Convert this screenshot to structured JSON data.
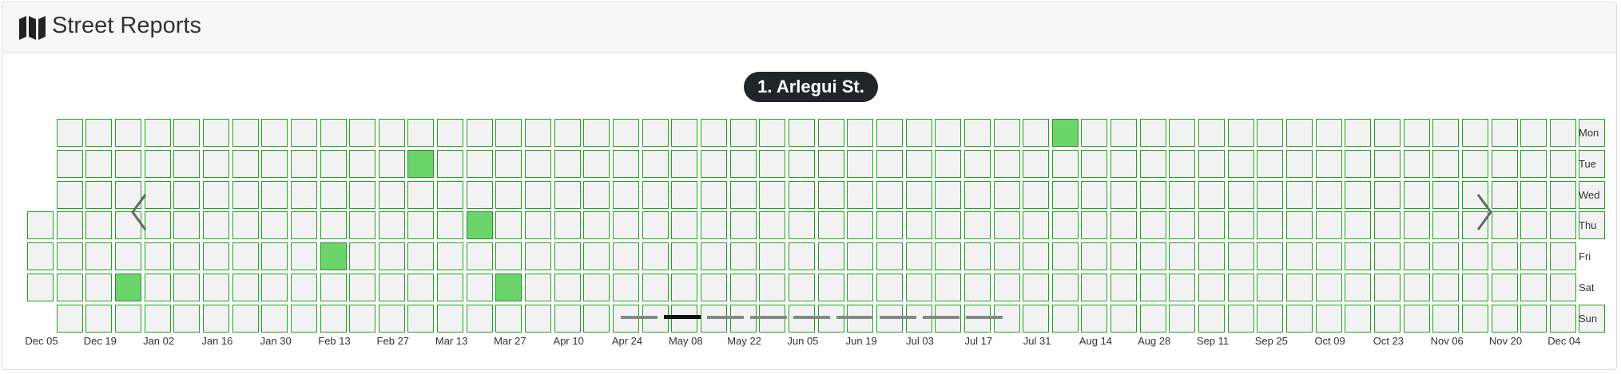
{
  "header": {
    "title": "Street Reports",
    "icon": "map-icon"
  },
  "carousel": {
    "current_street": "1. Arlegui St.",
    "indicator_count": 9,
    "active_indicator": 1,
    "prev_icon": "chevron-left-icon",
    "next_icon": "chevron-right-icon"
  },
  "calendar": {
    "day_labels": [
      "Mon",
      "Tue",
      "Wed",
      "Thu",
      "Fri",
      "Sat",
      "Sun"
    ],
    "month_labels": [
      "Dec 05",
      "Dec 19",
      "Jan 02",
      "Jan 16",
      "Jan 30",
      "Feb 13",
      "Feb 27",
      "Mar 13",
      "Mar 27",
      "Apr 10",
      "Apr 24",
      "May 08",
      "May 22",
      "Jun 05",
      "Jun 19",
      "Jul 03",
      "Jul 17",
      "Jul 31",
      "Aug 14",
      "Aug 28",
      "Sep 11",
      "Sep 25",
      "Oct 09",
      "Oct 23",
      "Nov 06",
      "Nov 20",
      "Dec 04"
    ],
    "week_count": 54,
    "first_week_days": [
      "Thu",
      "Fri",
      "Sat"
    ],
    "last_week_days": [
      "Mon",
      "Tue",
      "Wed",
      "Thu",
      "Sun"
    ],
    "reported_days": [
      {
        "week": 3,
        "day": "Sat"
      },
      {
        "week": 10,
        "day": "Fri"
      },
      {
        "week": 13,
        "day": "Tue"
      },
      {
        "week": 15,
        "day": "Thu"
      },
      {
        "week": 16,
        "day": "Sat"
      },
      {
        "week": 35,
        "day": "Mon"
      }
    ],
    "colors": {
      "empty_fill": "#f2f2f2",
      "reported_fill": "#6bd46b",
      "cell_border": "#1fa11f"
    }
  }
}
